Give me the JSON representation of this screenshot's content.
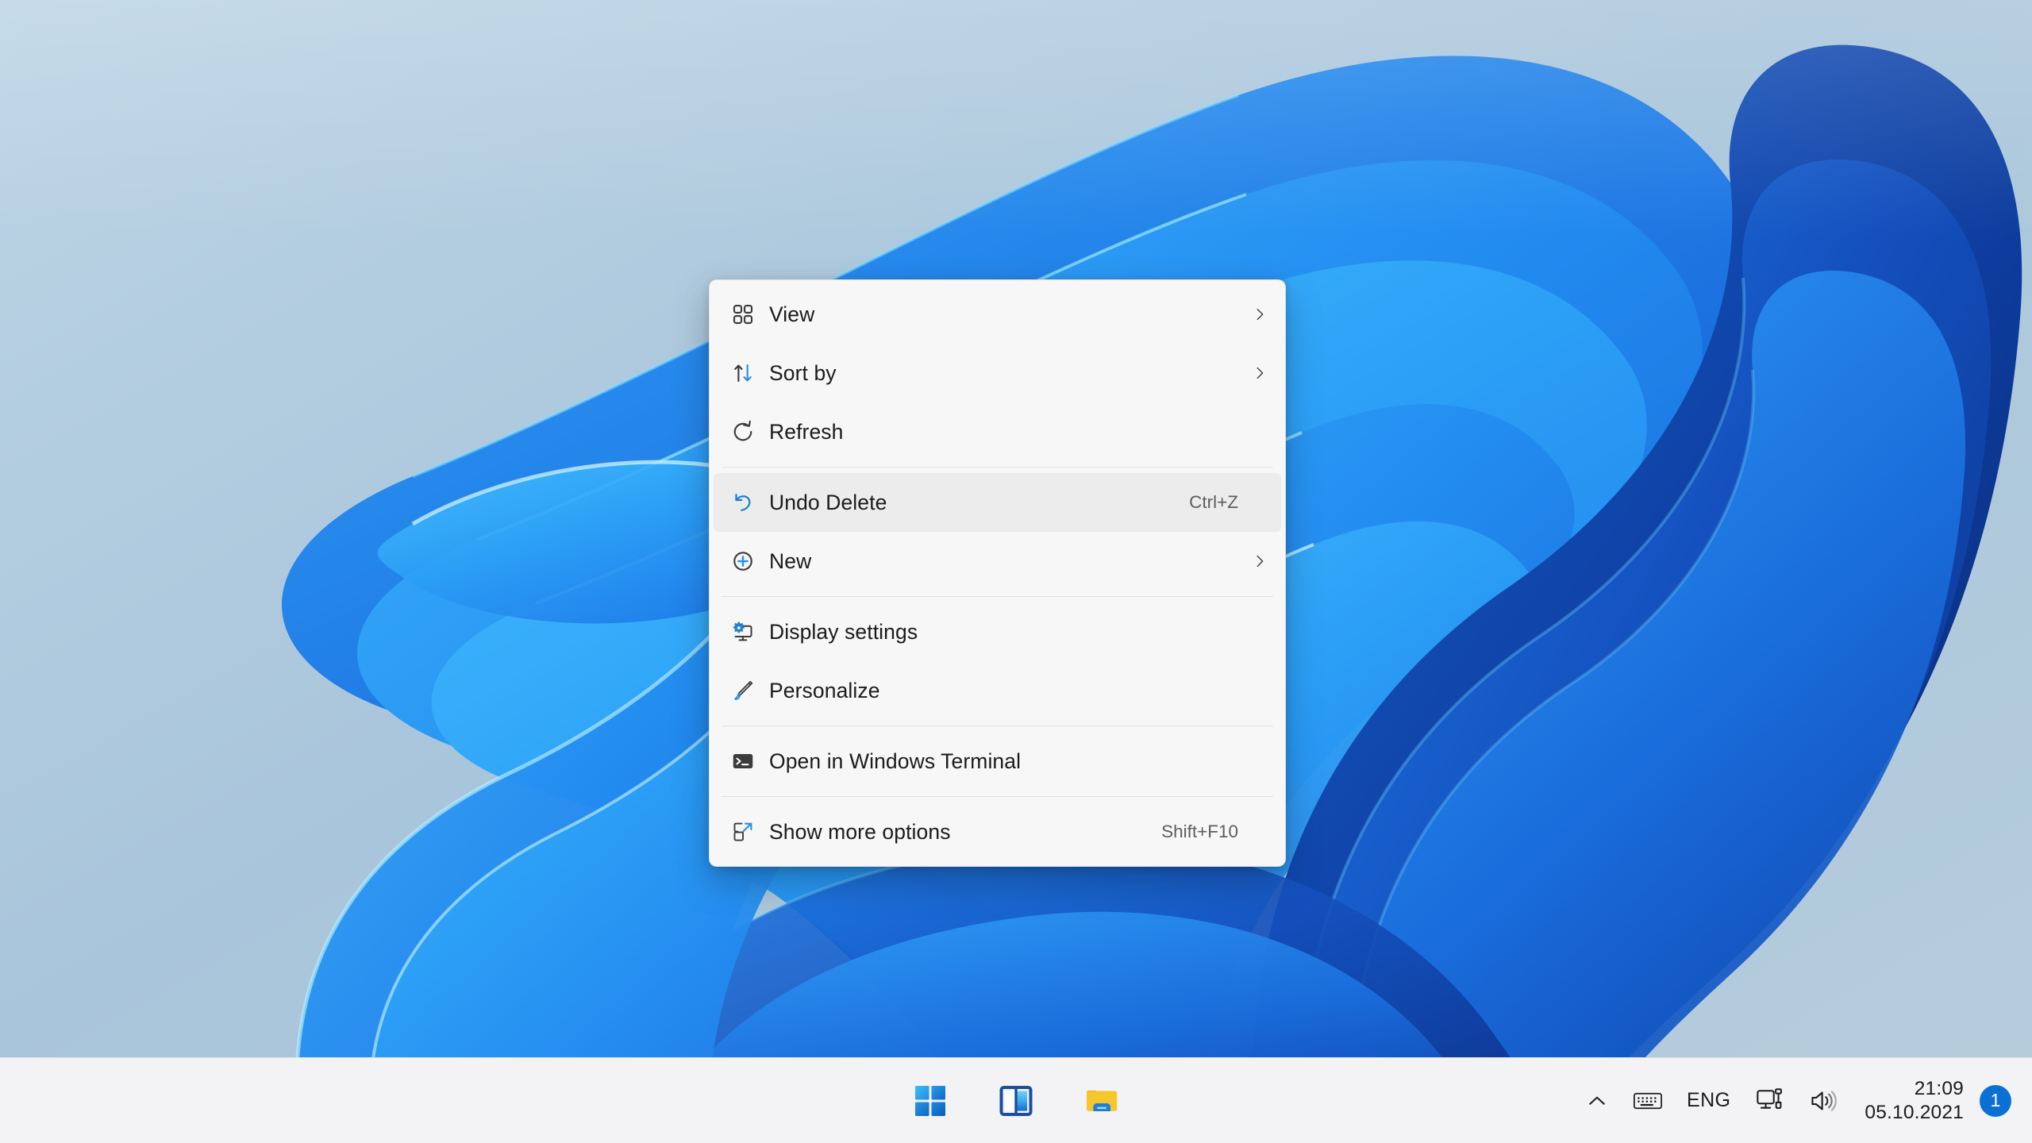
{
  "desktop": {
    "wallpaper_name": "windows-11-bloom-wallpaper",
    "colors": {
      "sky_light": "#b9d2e4",
      "sky_mid": "#a8c4da",
      "sky_deep": "#9cbad4",
      "bloom_cyan": "#35b4fb",
      "bloom_bright": "#2a9df4",
      "bloom_blue": "#1d7ff0",
      "bloom_mid": "#1667dd",
      "bloom_deep": "#1048b8",
      "bloom_dark": "#0b3490",
      "bloom_darkest": "#082a70"
    }
  },
  "context_menu": {
    "name": "desktop-context-menu",
    "groups": [
      {
        "items": [
          {
            "id": "view",
            "label": "View",
            "icon": "grid-view-icon",
            "accel": "",
            "submenu": true,
            "selected": false
          },
          {
            "id": "sort-by",
            "label": "Sort by",
            "icon": "sort-arrows-icon",
            "accel": "",
            "submenu": true,
            "selected": false
          },
          {
            "id": "refresh",
            "label": "Refresh",
            "icon": "refresh-icon",
            "accel": "",
            "submenu": false,
            "selected": false
          }
        ]
      },
      {
        "items": [
          {
            "id": "undo-delete",
            "label": "Undo Delete",
            "icon": "undo-icon",
            "accel": "Ctrl+Z",
            "submenu": false,
            "selected": true
          },
          {
            "id": "new",
            "label": "New",
            "icon": "plus-circle-icon",
            "accel": "",
            "submenu": true,
            "selected": false
          }
        ]
      },
      {
        "items": [
          {
            "id": "display-settings",
            "label": "Display settings",
            "icon": "monitor-gear-icon",
            "accel": "",
            "submenu": false,
            "selected": false
          },
          {
            "id": "personalize",
            "label": "Personalize",
            "icon": "paintbrush-icon",
            "accel": "",
            "submenu": false,
            "selected": false
          }
        ]
      },
      {
        "items": [
          {
            "id": "open-in-windows-terminal",
            "label": "Open in Windows Terminal",
            "icon": "terminal-icon",
            "accel": "",
            "submenu": false,
            "selected": false
          }
        ]
      },
      {
        "items": [
          {
            "id": "show-more-options",
            "label": "Show more options",
            "icon": "show-more-icon",
            "accel": "Shift+F10",
            "submenu": false,
            "selected": false
          }
        ]
      }
    ]
  },
  "taskbar": {
    "center_buttons": [
      {
        "id": "start",
        "label": "Start",
        "icon": "windows-start-icon"
      },
      {
        "id": "task-view",
        "label": "Task view",
        "icon": "task-view-icon"
      },
      {
        "id": "file-explorer",
        "label": "File Explorer",
        "icon": "file-explorer-icon"
      }
    ],
    "tray": {
      "overflow_icon": "chevron-up-icon",
      "keyboard_icon": "keyboard-icon",
      "language": "ENG",
      "network_icon": "network-icon",
      "volume_icon": "volume-icon",
      "time": "21:09",
      "date": "05.10.2021",
      "notification_count": "1",
      "notification_color": "#0b6fd4"
    }
  }
}
